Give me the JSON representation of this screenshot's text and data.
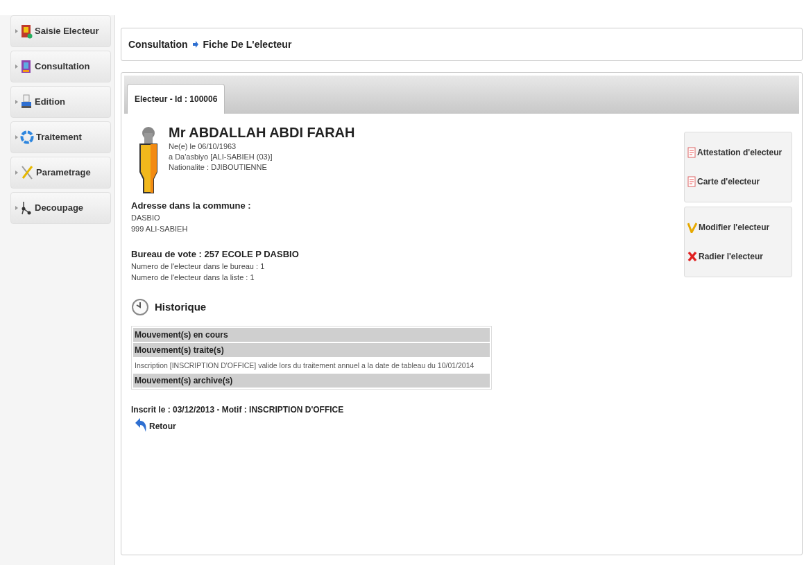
{
  "sidebar": {
    "items": [
      {
        "label": "Saisie Electeur",
        "kind": "register"
      },
      {
        "label": "Consultation",
        "kind": "consult"
      },
      {
        "label": "Edition",
        "kind": "print"
      },
      {
        "label": "Traitement",
        "kind": "process"
      },
      {
        "label": "Parametrage",
        "kind": "tools"
      },
      {
        "label": "Decoupage",
        "kind": "split"
      }
    ]
  },
  "breadcrumb": [
    "Consultation",
    "Fiche De L'electeur"
  ],
  "tabs": [
    {
      "label": "Electeur - Id : 100006",
      "selected": true
    }
  ],
  "person": {
    "name": "Mr ABDALLAH ABDI FARAH",
    "lines": [
      "Ne(e) le 06/10/1963",
      "a Da'asbiyo [ALI-SABIEH (03)]",
      "Nationalite : DJIBOUTIENNE"
    ]
  },
  "address": {
    "title": "Adresse dans la commune :",
    "lines": [
      "DASBIO",
      "999 ALI-SABIEH"
    ]
  },
  "bureau": {
    "title": "Bureau de vote : 257 ECOLE P DASBIO",
    "lines": [
      "Numero de l'electeur dans le bureau : 1",
      "Numero de l'electeur dans la liste : 1"
    ]
  },
  "history": {
    "title": "Historique",
    "rows": [
      {
        "kind": "header",
        "text": "Mouvement(s) en cours"
      },
      {
        "kind": "header",
        "text": "Mouvement(s) traite(s)"
      },
      {
        "kind": "item",
        "text": "Inscription [INSCRIPTION D'OFFICE] valide lors du traitement annuel a la date de tableau du 10/01/2014"
      },
      {
        "kind": "header",
        "text": "Mouvement(s) archive(s)"
      }
    ]
  },
  "inscription": "Inscrit le : 03/12/2013 - Motif : INSCRIPTION D'OFFICE",
  "back": "Retour",
  "actions": [
    [
      {
        "label": "Attestation d'electeur",
        "kind": "document"
      },
      {
        "label": "Carte d'electeur",
        "kind": "document"
      }
    ],
    [
      {
        "label": "Modifier l'electeur",
        "kind": "edit"
      },
      {
        "label": "Radier l'electeur",
        "kind": "delete"
      }
    ]
  ]
}
